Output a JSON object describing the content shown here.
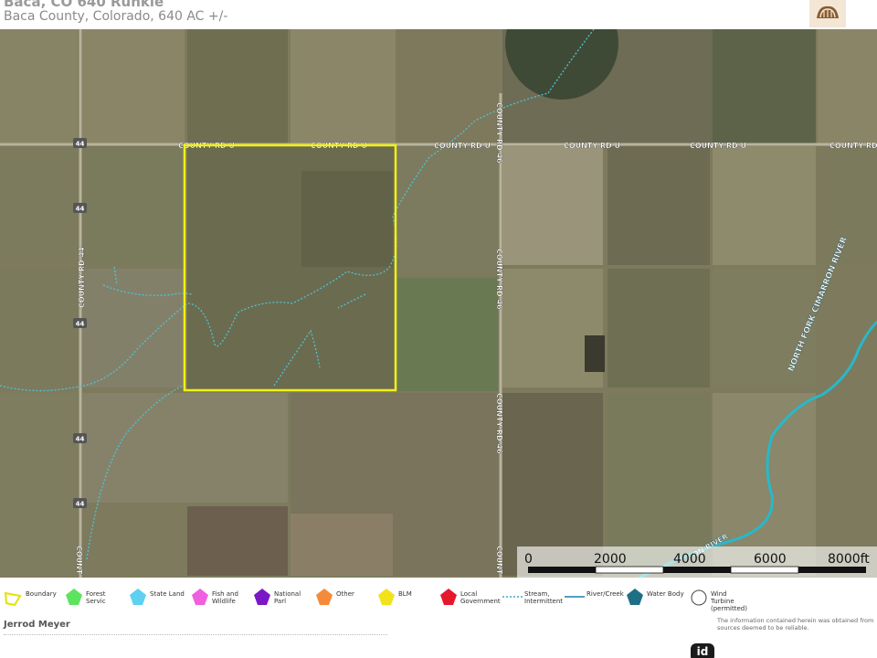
{
  "header": {
    "title": "Baca, CO 640 Runkle",
    "subtitle": "Baca County, Colorado, 640 AC +/-",
    "logo_icon": "brand-logo-icon"
  },
  "map": {
    "roads": {
      "county_rd_u": "COUNTY RD U",
      "county_rd_46": "COUNTY RD 46",
      "county_rd_44": "COUNTY RD 44",
      "county_short": "COUNT",
      "route_44": "44"
    },
    "river_label": "NORTH FORK CIMARRON RIVER",
    "river_label_bottom": "ON RIVER",
    "boundary_color": "#f1f111",
    "stream_color": "#4fc3d4",
    "river_color": "#27b9c9",
    "scale_bar": {
      "ticks": [
        "0",
        "2000",
        "4000",
        "6000",
        "8000ft"
      ]
    }
  },
  "legend": {
    "items": [
      {
        "label": "Boundary",
        "color": "#e3e300",
        "icon": "boundary-icon"
      },
      {
        "label": "Forest Servic",
        "color": "#5ee35e",
        "icon": "forest-service-icon"
      },
      {
        "label": "State Land",
        "color": "#5ed0f2",
        "icon": "state-land-icon"
      },
      {
        "label": "Fish and Wildlife",
        "color": "#f05fe0",
        "icon": "fish-wildlife-icon"
      },
      {
        "label": "National Parl",
        "color": "#7a18c8",
        "icon": "national-park-icon"
      },
      {
        "label": "Other",
        "color": "#f58a3a",
        "icon": "other-icon"
      },
      {
        "label": "BLM",
        "color": "#f2e21c",
        "icon": "blm-icon"
      },
      {
        "label": "Local Government",
        "color": "#e6182c",
        "icon": "local-government-icon"
      },
      {
        "label": "Stream, Intermittent",
        "color": "#3fa6c6",
        "icon": "stream-intermittent-icon"
      },
      {
        "label": "River/Creek",
        "color": "#1f7ea8",
        "icon": "river-creek-icon"
      },
      {
        "label": "Water Body",
        "color": "#1e6f86",
        "icon": "water-body-icon"
      },
      {
        "label": "Wind Turbine (permitted)",
        "color": "#ffffff",
        "icon": "wind-turbine-icon"
      }
    ]
  },
  "footer": {
    "agent_name": "Jerrod Meyer",
    "disclaimer": "The information contained herein was obtained from sources deemed to be reliable.",
    "badge": "id"
  }
}
